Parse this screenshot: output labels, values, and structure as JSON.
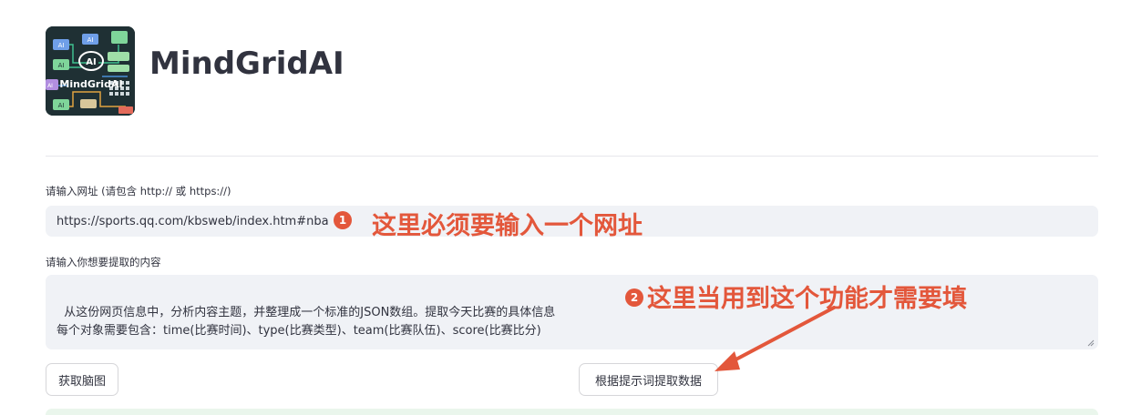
{
  "header": {
    "title": "MindGridAI",
    "logo": {
      "icon": "mindgrid-logo-icon",
      "node_labels": [
        "AI",
        "AI",
        "AI",
        "AI",
        "AI"
      ],
      "brand_text": "MindGridAI",
      "center_text": "AI"
    }
  },
  "url_field": {
    "label": "请输入网址 (请包含 http:// 或 https://)",
    "value": "https://sports.qq.com/kbsweb/index.htm#nba"
  },
  "prompt_field": {
    "label": "请输入你想要提取的内容",
    "value": "从这份网页信息中，分析内容主题，并整理成一个标准的JSON数组。提取今天比赛的具体信息\n每个对象需要包含：time(比赛时间)、type(比赛类型)、team(比赛队伍)、score(比赛比分)"
  },
  "buttons": {
    "mindmap": "获取脑图",
    "extract": "根据提示词提取数据"
  },
  "annotations": {
    "badge_1": "1",
    "note_1": "这里必须要输入一个网址",
    "badge_2": "2",
    "note_2": "这里当用到这个功能才需要填"
  },
  "colors": {
    "accent": "#e3573b",
    "input_bg": "#f0f2f6",
    "text": "#31333f",
    "success_bg": "#eaf6ec"
  }
}
